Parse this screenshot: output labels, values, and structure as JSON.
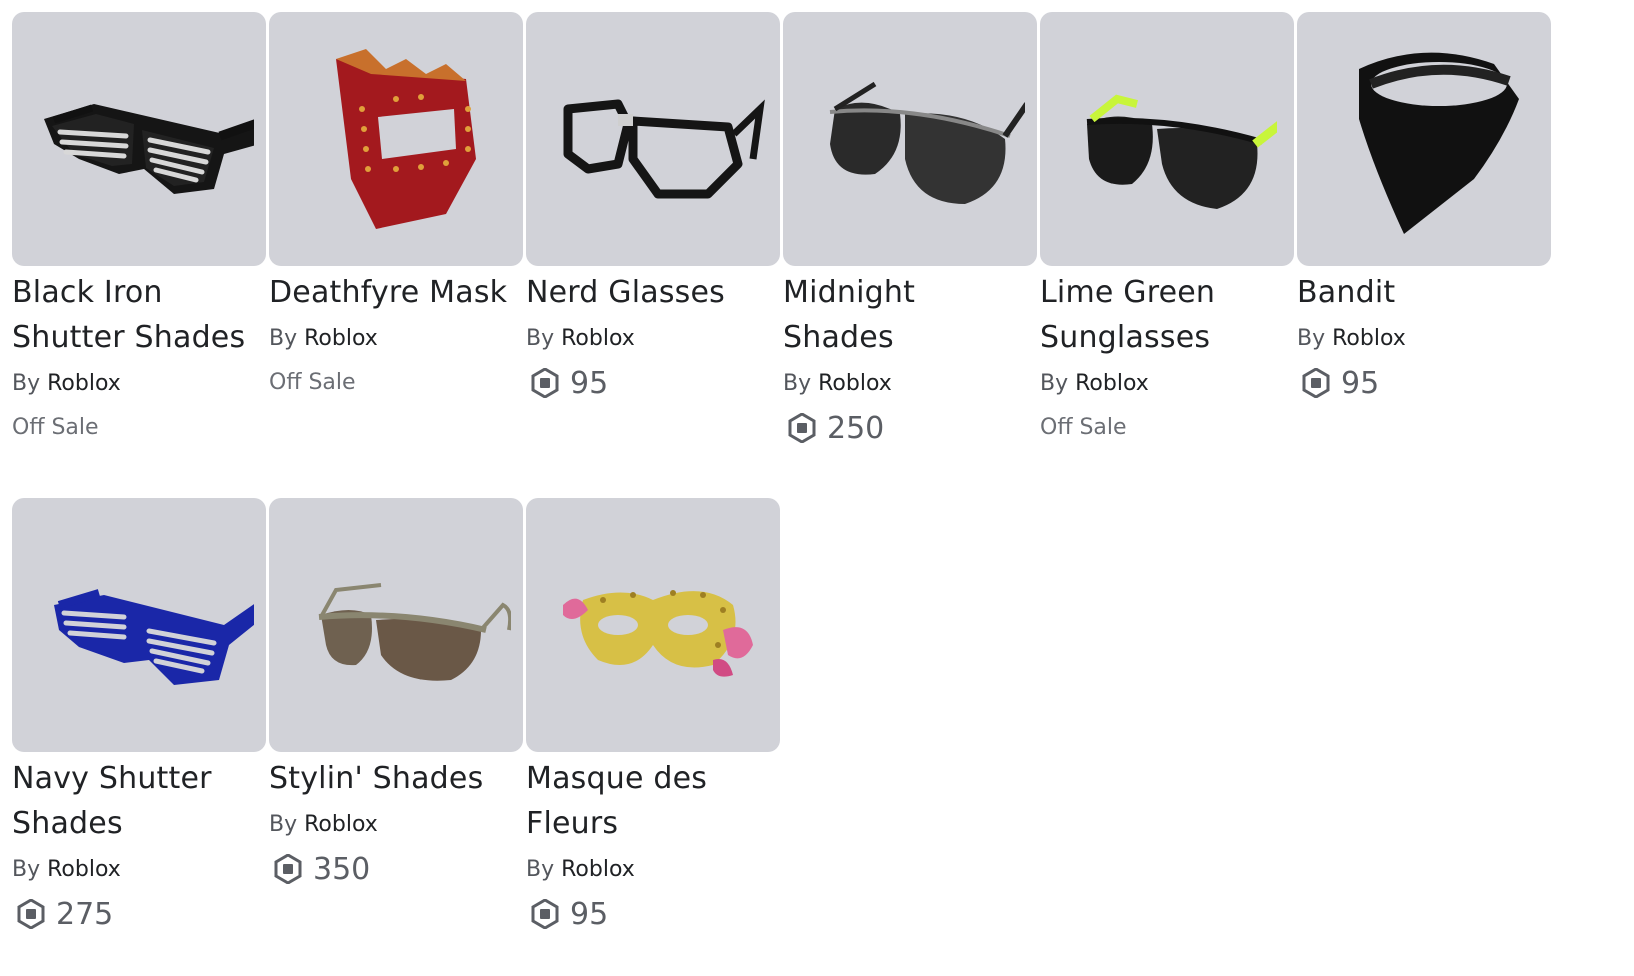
{
  "items": [
    {
      "name_lines": [
        "Black Iron",
        "Shutter Shades"
      ],
      "by": "By",
      "creator": "Roblox",
      "off_sale": "Off Sale",
      "price": null,
      "icon": "black-iron-shutter-shades-image"
    },
    {
      "name_lines": [
        "Deathfyre Mask"
      ],
      "by": "By",
      "creator": "Roblox",
      "off_sale": "Off Sale",
      "price": null,
      "icon": "deathfyre-mask-image"
    },
    {
      "name_lines": [
        "Nerd Glasses"
      ],
      "by": "By",
      "creator": "Roblox",
      "off_sale": null,
      "price": "95",
      "icon": "nerd-glasses-image"
    },
    {
      "name_lines": [
        "Midnight",
        "Shades"
      ],
      "by": "By",
      "creator": "Roblox",
      "off_sale": null,
      "price": "250",
      "icon": "midnight-shades-image"
    },
    {
      "name_lines": [
        "Lime Green",
        "Sunglasses"
      ],
      "by": "By",
      "creator": "Roblox",
      "off_sale": "Off Sale",
      "price": null,
      "icon": "lime-green-sunglasses-image"
    },
    {
      "name_lines": [
        "Bandit"
      ],
      "by": "By",
      "creator": "Roblox",
      "off_sale": null,
      "price": "95",
      "icon": "bandit-image"
    },
    {
      "name_lines": [
        "Navy Shutter",
        "Shades"
      ],
      "by": "By",
      "creator": "Roblox",
      "off_sale": null,
      "price": "275",
      "icon": "navy-shutter-shades-image"
    },
    {
      "name_lines": [
        "Stylin' Shades"
      ],
      "by": "By",
      "creator": "Roblox",
      "off_sale": null,
      "price": "350",
      "icon": "stylin-shades-image"
    },
    {
      "name_lines": [
        "Masque des",
        "Fleurs"
      ],
      "by": "By",
      "creator": "Roblox",
      "off_sale": null,
      "price": "95",
      "icon": "masque-des-fleurs-image"
    }
  ],
  "colors": {
    "thumb_bg": "#d1d2d8",
    "text_primary": "#202225",
    "text_secondary": "#53565c",
    "price_text": "#5b5e64"
  },
  "currency_icon": "robux-icon"
}
